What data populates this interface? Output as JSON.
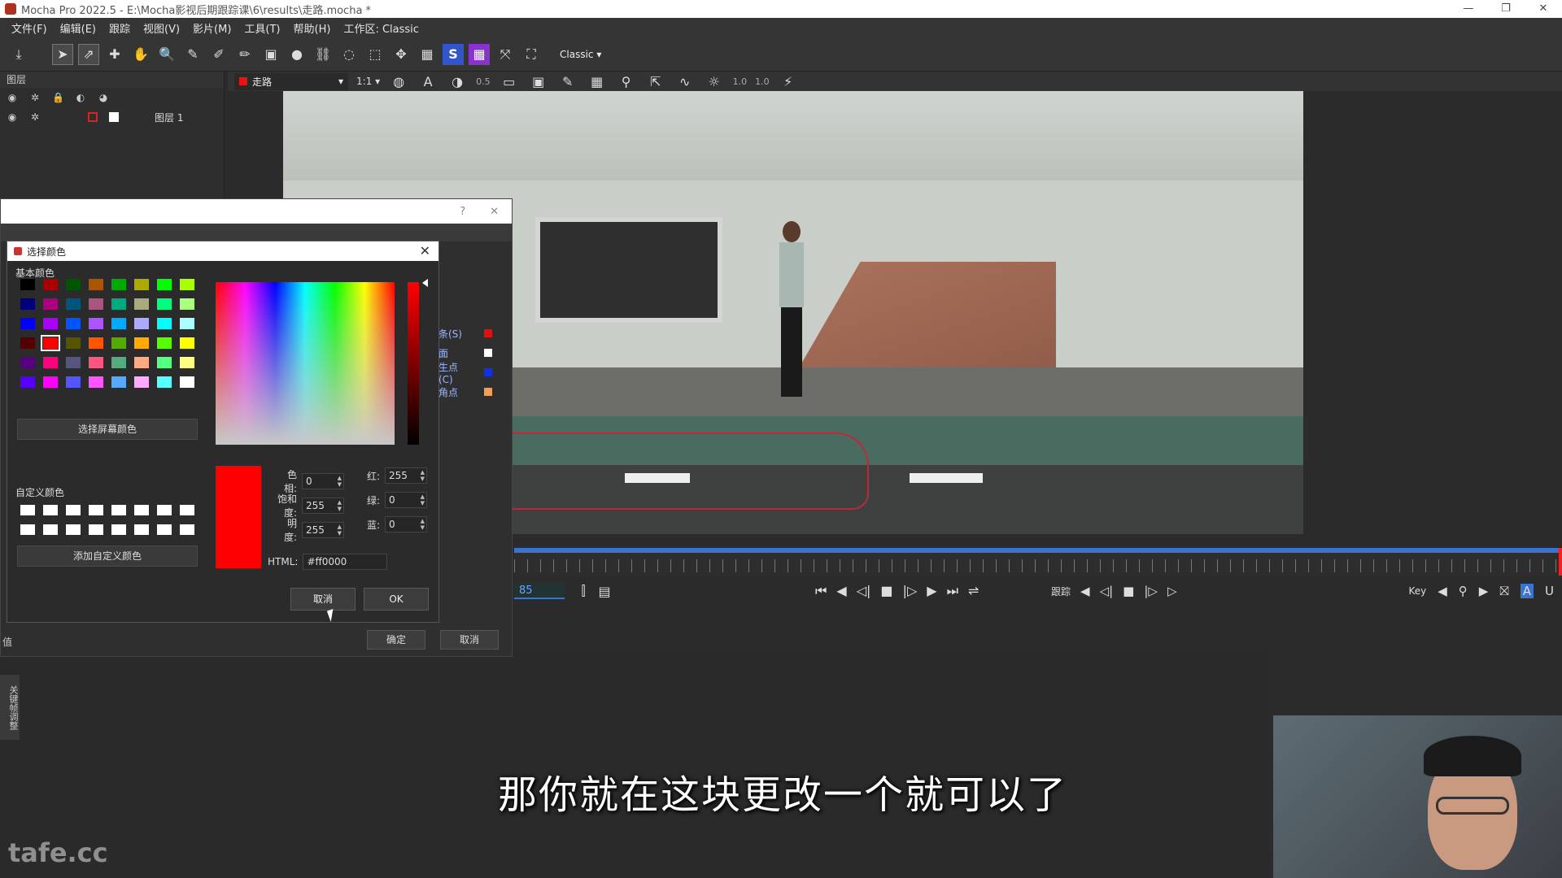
{
  "app": {
    "title": "Mocha Pro 2022.5 - E:\\Mocha影视后期跟踪课\\6\\results\\走路.mocha *",
    "window_controls": [
      "—",
      "❐",
      "✕"
    ]
  },
  "menu": [
    "文件(F)",
    "编辑(E)",
    "跟踪",
    "视图(V)",
    "影片(M)",
    "工具(T)",
    "帮助(H)",
    "工作区: Classic"
  ],
  "toolbar": {
    "workspace_select": "Classic"
  },
  "layers_panel": {
    "title": "图层",
    "layer_name": "图层 1"
  },
  "viewer": {
    "clip_name": "走路",
    "zoom": "1:1",
    "value_a": "0.5",
    "value_b": "1.0",
    "value_c": "1.0"
  },
  "transport": {
    "frame": "85",
    "track_label": "跟踪",
    "key_label": "Key"
  },
  "parent_dialog": {
    "labels": [
      {
        "text": "条(S)",
        "color": "#e01010"
      },
      {
        "text": "面",
        "color": "#ffffff"
      },
      {
        "text": "生点(C)",
        "color": "#1030ee"
      },
      {
        "text": "角点",
        "color": "#f0a050"
      }
    ],
    "confirm": "确定",
    "cancel": "取消",
    "value_label": "值"
  },
  "color_dialog": {
    "title": "选择颜色",
    "basic_colors_label": "基本颜色",
    "pick_screen_color": "选择屏幕颜色",
    "custom_colors_label": "自定义颜色",
    "add_custom_color": "添加自定义颜色",
    "hue_label": "色相:",
    "hue": "0",
    "sat_label": "饱和度:",
    "sat": "255",
    "val_label": "明度:",
    "val": "255",
    "red_label": "红:",
    "red": "255",
    "green_label": "绿:",
    "green": "0",
    "blue_label": "蓝:",
    "blue": "0",
    "html_label": "HTML:",
    "html": "#ff0000",
    "cancel": "取消",
    "ok": "OK",
    "current_color": "#ff0000",
    "basic_colors": [
      "#000000",
      "#aa0000",
      "#005500",
      "#aa5500",
      "#00aa00",
      "#aaaa00",
      "#00ff00",
      "#aaff00",
      "#00007f",
      "#aa007f",
      "#00557f",
      "#aa557f",
      "#00aa7f",
      "#aaaa7f",
      "#00ff7f",
      "#aaff7f",
      "#0000ff",
      "#aa00ff",
      "#0055ff",
      "#aa55ff",
      "#00aaff",
      "#aaaaff",
      "#00ffff",
      "#aaffff",
      "#550000",
      "#ff0000",
      "#555500",
      "#ff5500",
      "#55aa00",
      "#ffaa00",
      "#55ff00",
      "#ffff00",
      "#55007f",
      "#ff007f",
      "#55557f",
      "#ff557f",
      "#55aa7f",
      "#ffaa7f",
      "#55ff7f",
      "#ffff7f",
      "#5500ff",
      "#ff00ff",
      "#5555ff",
      "#ff55ff",
      "#55aaff",
      "#ffaaff",
      "#55ffff",
      "#ffffff"
    ]
  },
  "subtitle": "那你就在这块更改一个就可以了",
  "watermark": "tafe.cc",
  "side_tab": "关键帧调整"
}
